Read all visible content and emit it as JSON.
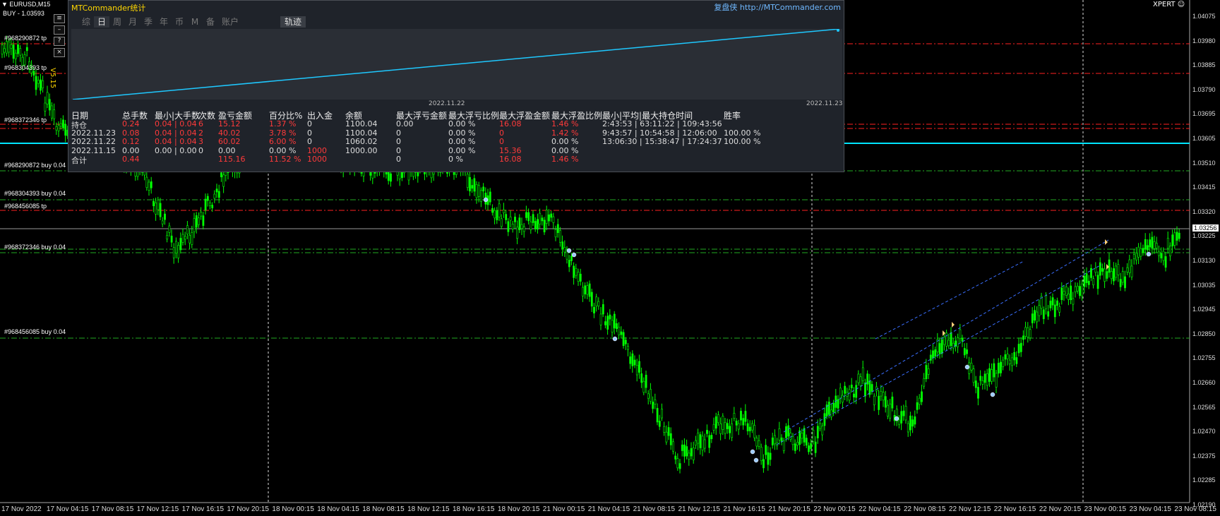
{
  "chart": {
    "symbol": "EURUSD,M15",
    "signal": "BUY - 1.03593",
    "ea_label": "XPERT ☺",
    "version": "V5.15",
    "current_price": "1.03256",
    "price_levels": [
      "1.04075",
      "1.03980",
      "1.03885",
      "1.03790",
      "1.03695",
      "1.03605",
      "1.03510",
      "1.03415",
      "1.03320",
      "1.03225",
      "1.03130",
      "1.03035",
      "1.02945",
      "1.02850",
      "1.02755",
      "1.02660",
      "1.02565",
      "1.02470",
      "1.02375",
      "1.02285",
      "1.02190"
    ],
    "time_labels": [
      "17 Nov 2022",
      "17 Nov 04:15",
      "17 Nov 08:15",
      "17 Nov 12:15",
      "17 Nov 16:15",
      "17 Nov 20:15",
      "18 Nov 00:15",
      "18 Nov 04:15",
      "18 Nov 08:15",
      "18 Nov 12:15",
      "18 Nov 16:15",
      "18 Nov 20:15",
      "21 Nov 00:15",
      "21 Nov 04:15",
      "21 Nov 08:15",
      "21 Nov 12:15",
      "21 Nov 16:15",
      "21 Nov 20:15",
      "22 Nov 00:15",
      "22 Nov 04:15",
      "22 Nov 08:15",
      "22 Nov 12:15",
      "22 Nov 16:15",
      "22 Nov 20:15",
      "23 Nov 00:15",
      "23 Nov 04:15",
      "23 Nov 08:15"
    ],
    "order_labels": [
      {
        "text": "#968290872 tp"
      },
      {
        "text": "#968304393 tp"
      },
      {
        "text": "#968372346 tp"
      },
      {
        "text": "#968290872 buy 0.04"
      },
      {
        "text": "#968304393 buy 0.04"
      },
      {
        "text": "#968456085 tp"
      },
      {
        "text": "#968372346 buy 0.04"
      },
      {
        "text": "#968456085 buy 0.04"
      }
    ]
  },
  "panel": {
    "title": "MTCommander统计",
    "brand_cn": "复盘侠",
    "brand_url": "http://MTCommander.com",
    "tabs": [
      "综",
      "日",
      "周",
      "月",
      "季",
      "年",
      "币",
      "M",
      "备",
      "账户"
    ],
    "active_tab": "日",
    "track_button": "轨迹",
    "curve_dates": [
      "2022.11.22",
      "2022.11.23"
    ],
    "headers": [
      "日期",
      "总手数",
      "最小|大手数",
      "次数",
      "盈亏金额",
      "百分比%",
      "出入金",
      "余额",
      "最大浮亏金额",
      "最大浮亏比例",
      "最大浮盈金额",
      "最大浮盈比例",
      "最小|平均|最大持仓时间",
      "胜率"
    ],
    "rows": [
      [
        "持仓",
        "0.24",
        "0.04 | 0.04",
        "6",
        "15.12",
        "1.37 %",
        "0",
        "1100.04",
        "0.00",
        "0.00 %",
        "16.08",
        "1.46 %",
        "2:43:53 | 63:11:22 | 109:43:56",
        ""
      ],
      [
        "2022.11.23",
        "0.08",
        "0.04 | 0.04",
        "2",
        "40.02",
        "3.78 %",
        "0",
        "1100.04",
        "0",
        "0.00 %",
        "0",
        "1.42 %",
        "9:43:57 | 10:54:58 | 12:06:00",
        "100.00 %"
      ],
      [
        "2022.11.22",
        "0.12",
        "0.04 | 0.04",
        "3",
        "60.02",
        "6.00 %",
        "0",
        "1060.02",
        "0",
        "0.00 %",
        "0",
        "0.00 %",
        "13:06:30 | 15:38:47 | 17:24:37",
        "100.00 %"
      ],
      [
        "2022.11.15",
        "0.00",
        "0.00 | 0.00",
        "0",
        "0.00",
        "0.00 %",
        "1000",
        "1000.00",
        "0",
        "0.00 %",
        "15.36",
        "0.00 %",
        "",
        ""
      ],
      [
        "合计",
        "0.44",
        "",
        "",
        "115.16",
        "11.52 %",
        "1000",
        "",
        "0",
        "0 %",
        "16.08",
        "1.46 %",
        "",
        ""
      ]
    ]
  },
  "colors": {
    "candle": "#00ff00",
    "tp_line": "#ff2020",
    "buy_line": "#22aa22",
    "bid_line": "#00e5ff",
    "panel_bg": "#1f232a",
    "curve": "#1ec8ff"
  },
  "icons": [
    "arrow-down-icon",
    "help-icon",
    "close-icon",
    "smiley-icon"
  ]
}
